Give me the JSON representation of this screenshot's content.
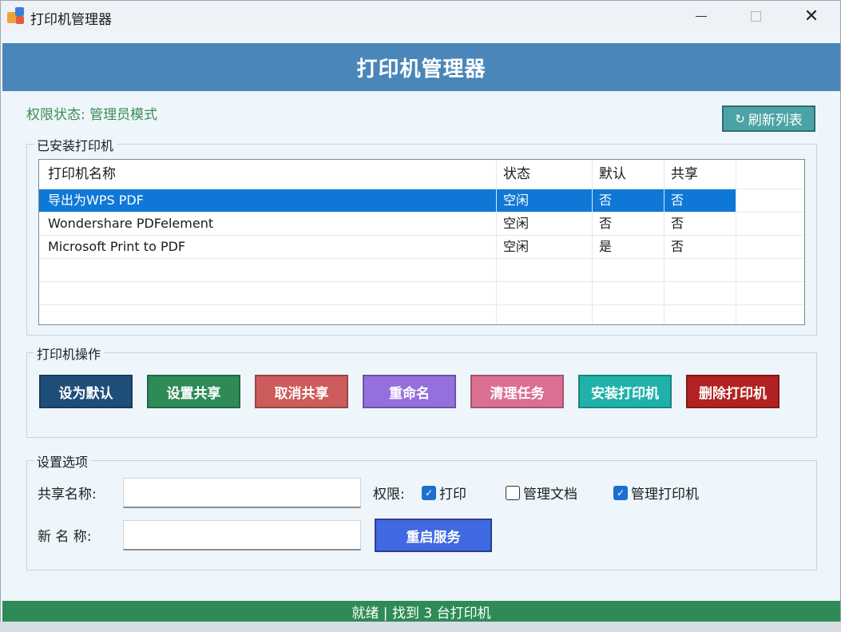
{
  "window": {
    "title": "打印机管理器",
    "minimize": "—",
    "maximize": "□",
    "close": "✕"
  },
  "header": {
    "title": "打印机管理器"
  },
  "status": {
    "permission": "权限状态: 管理员模式"
  },
  "refresh": {
    "icon": "↻",
    "label": "刷新列表"
  },
  "printers_group": {
    "title": "已安装打印机",
    "columns": [
      "打印机名称",
      "状态",
      "默认",
      "共享"
    ],
    "rows": [
      [
        "导出为WPS PDF",
        "空闲",
        "否",
        "否"
      ],
      [
        "Wondershare PDFelement",
        "空闲",
        "否",
        "否"
      ],
      [
        "Microsoft Print to PDF",
        "空闲",
        "是",
        "否"
      ]
    ]
  },
  "actions_group": {
    "title": "打印机操作",
    "buttons": [
      {
        "label": "设为默认",
        "color": "#1f4e79"
      },
      {
        "label": "设置共享",
        "color": "#2e8b57"
      },
      {
        "label": "取消共享",
        "color": "#cd5c5c"
      },
      {
        "label": "重命名",
        "color": "#9370db"
      },
      {
        "label": "清理任务",
        "color": "#db7093"
      },
      {
        "label": "安装打印机",
        "color": "#20b2aa"
      },
      {
        "label": "删除打印机",
        "color": "#b22222"
      }
    ]
  },
  "settings_group": {
    "title": "设置选项",
    "share_name_label": "共享名称:",
    "new_name_label": "新 名 称:",
    "permission_label": "权限:",
    "perm_print": {
      "label": "打印",
      "checked": true
    },
    "perm_manage_docs": {
      "label": "管理文档",
      "checked": false
    },
    "perm_manage_printer": {
      "label": "管理打印机",
      "checked": true
    },
    "restart_label": "重启服务"
  },
  "statusbar": {
    "text": "就绪 | 找到 3 台打印机"
  },
  "colors": {
    "header": "#4a86b9",
    "accent_green": "#2e8b57",
    "selection": "#0f78d7",
    "restart": "#4169e1"
  }
}
